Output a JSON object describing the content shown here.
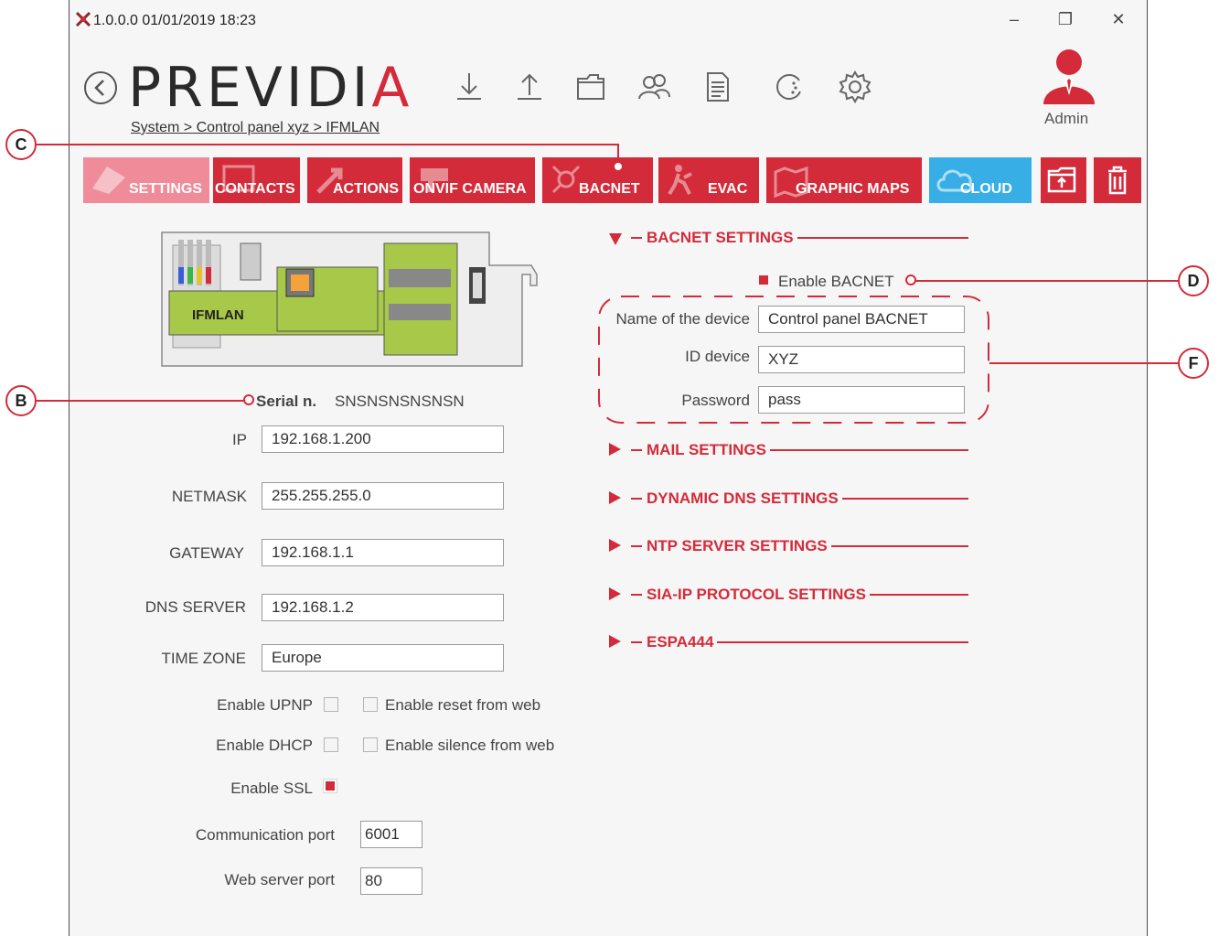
{
  "window": {
    "title": "1.0.0.0 01/01/2019 18:23"
  },
  "header": {
    "logo": {
      "main": "PREVIDI",
      "accent": "A"
    },
    "breadcrumb": "System > Control panel xyz > IFMLAN",
    "toolbar_icons": [
      "back-icon",
      "download-icon",
      "upload-icon",
      "folder-icon",
      "users-icon",
      "document-icon",
      "history-icon",
      "gear-icon"
    ],
    "user": {
      "name": "Admin"
    }
  },
  "tabs": [
    {
      "label": "SETTINGS",
      "active": true
    },
    {
      "label": "CONTACTS"
    },
    {
      "label": "ACTIONS"
    },
    {
      "label": "ONVIF CAMERA"
    },
    {
      "label": "BACNET"
    },
    {
      "label": "EVAC"
    },
    {
      "label": "GRAPHIC MAPS"
    },
    {
      "label": "CLOUD"
    }
  ],
  "device_image": {
    "label": "IFMLAN"
  },
  "network": {
    "serial_label": "Serial n.",
    "serial_value": "SNSNSNSNSNSN",
    "ip_label": "IP",
    "ip_value": "192.168.1.200",
    "netmask_label": "NETMASK",
    "netmask_value": "255.255.255.0",
    "gateway_label": "GATEWAY",
    "gateway_value": "192.168.1.1",
    "dns_label": "DNS SERVER",
    "dns_value": "192.168.1.2",
    "timezone_label": "TIME ZONE",
    "timezone_value": "Europe",
    "enable_upnp": "Enable UPNP",
    "enable_reset_web": "Enable reset from web",
    "enable_dhcp": "Enable DHCP",
    "enable_silence_web": "Enable silence from web",
    "enable_ssl": "Enable SSL",
    "comm_port_label": "Communication port",
    "comm_port_value": "6001",
    "web_port_label": "Web server port",
    "web_port_value": "80"
  },
  "bacnet": {
    "section_title": "BACNET SETTINGS",
    "enable_label": "Enable BACNET",
    "name_label": "Name of the device",
    "name_value": "Control panel BACNET",
    "id_label": "ID device",
    "id_value": "XYZ",
    "password_label": "Password",
    "password_value": "pass"
  },
  "sections": [
    "MAIL SETTINGS",
    "DYNAMIC DNS SETTINGS",
    "NTP SERVER SETTINGS",
    "SIA-IP PROTOCOL SETTINGS",
    "ESPA444"
  ],
  "callouts": {
    "b": "B",
    "c": "C",
    "d": "D",
    "f": "F"
  },
  "colors": {
    "accent": "#d42b3a",
    "active_tab": "#f08c99",
    "cloud": "#37aee6",
    "board": "#a8c84a"
  }
}
